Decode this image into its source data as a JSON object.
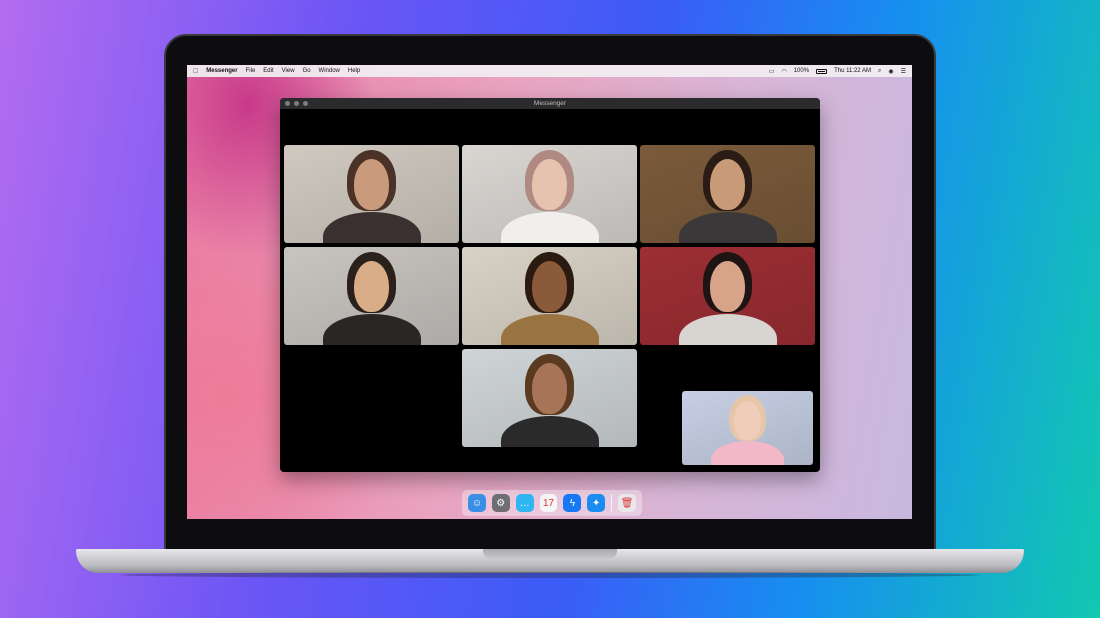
{
  "menubar": {
    "apple_icon": "apple-logo-icon",
    "app_name": "Messenger",
    "items": [
      "File",
      "Edit",
      "View",
      "Go",
      "Window",
      "Help"
    ],
    "battery": "100%",
    "clock": "Thu 11:22 AM"
  },
  "window": {
    "title": "Messenger"
  },
  "participants": [
    {
      "tile": "participant-1",
      "bg": "#cfc9c0",
      "skin": "#c99a7c",
      "hair": "#4a3226",
      "shirt": "#3a3030"
    },
    {
      "tile": "participant-2",
      "bg": "#d9d6d2",
      "skin": "#e7c2ae",
      "hair": "#b08a82",
      "shirt": "#f1efee"
    },
    {
      "tile": "participant-3",
      "bg": "#7a5a3a",
      "skin": "#c89a78",
      "hair": "#2a1c14",
      "shirt": "#3a3838"
    },
    {
      "tile": "participant-4",
      "bg": "#c8c4c0",
      "skin": "#d8ad88",
      "hair": "#2a211b",
      "shirt": "#2a2624"
    },
    {
      "tile": "participant-5",
      "bg": "#d8d2c6",
      "skin": "#8a5a3a",
      "hair": "#2b1a10",
      "shirt": "#9a7440"
    },
    {
      "tile": "participant-6",
      "bg": "#9c2e34",
      "skin": "#d7a48a",
      "hair": "#1e1414",
      "shirt": "#d8d4d0"
    },
    {
      "tile": "participant-7",
      "bg": "#cfd4d6",
      "skin": "#a87458",
      "hair": "#5a3a20",
      "shirt": "#2a2a2a"
    },
    {
      "tile": "self-view",
      "bg": "#c6cfe4",
      "skin": "#f0cdb8",
      "hair": "#e6c6a8",
      "shirt": "#f2b8c8"
    }
  ],
  "dock": [
    {
      "name": "finder-icon",
      "color": "#3a8ee6",
      "glyph": "☺"
    },
    {
      "name": "system-preferences-icon",
      "color": "#6e6e73",
      "glyph": "⚙"
    },
    {
      "name": "messages-icon",
      "color": "#2fb5f0",
      "glyph": "…"
    },
    {
      "name": "calendar-icon",
      "color": "#f5f5f5",
      "glyph": "17"
    },
    {
      "name": "messenger-icon",
      "color": "#1877f2",
      "glyph": "ϟ"
    },
    {
      "name": "safari-icon",
      "color": "#1a8cf0",
      "glyph": "✦"
    },
    {
      "name": "trash-icon",
      "color": "#e8e8ea",
      "glyph": "🗑"
    }
  ]
}
